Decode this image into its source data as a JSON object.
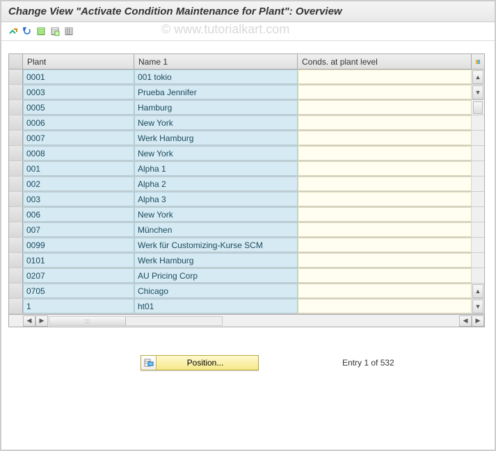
{
  "window": {
    "title": "Change View \"Activate Condition Maintenance for Plant\": Overview"
  },
  "watermark": "© www.tutorialkart.com",
  "toolbar_icons": [
    "change-display-toggle",
    "undo",
    "select-all",
    "deselect-all",
    "table-settings"
  ],
  "columns": {
    "plant": "Plant",
    "name": "Name 1",
    "conds": "Conds. at plant level"
  },
  "rows": [
    {
      "plant": "0001",
      "name": "001 tokio",
      "conds": ""
    },
    {
      "plant": "0003",
      "name": "Prueba Jennifer",
      "conds": ""
    },
    {
      "plant": "0005",
      "name": "Hamburg",
      "conds": ""
    },
    {
      "plant": "0006",
      "name": "New York",
      "conds": ""
    },
    {
      "plant": "0007",
      "name": "Werk Hamburg",
      "conds": ""
    },
    {
      "plant": "0008",
      "name": "New York",
      "conds": ""
    },
    {
      "plant": "001",
      "name": "Alpha 1",
      "conds": ""
    },
    {
      "plant": "002",
      "name": "Alpha 2",
      "conds": ""
    },
    {
      "plant": "003",
      "name": "Alpha 3",
      "conds": ""
    },
    {
      "plant": "006",
      "name": "New York",
      "conds": ""
    },
    {
      "plant": "007",
      "name": "München",
      "conds": ""
    },
    {
      "plant": "0099",
      "name": "Werk für Customizing-Kurse SCM",
      "conds": ""
    },
    {
      "plant": "0101",
      "name": "Werk Hamburg",
      "conds": ""
    },
    {
      "plant": "0207",
      "name": "AU Pricing Corp",
      "conds": ""
    },
    {
      "plant": "0705",
      "name": "Chicago",
      "conds": ""
    },
    {
      "plant": "1",
      "name": "ht01",
      "conds": ""
    }
  ],
  "footer": {
    "position_label": "Position...",
    "entry_text": "Entry 1 of 532"
  }
}
